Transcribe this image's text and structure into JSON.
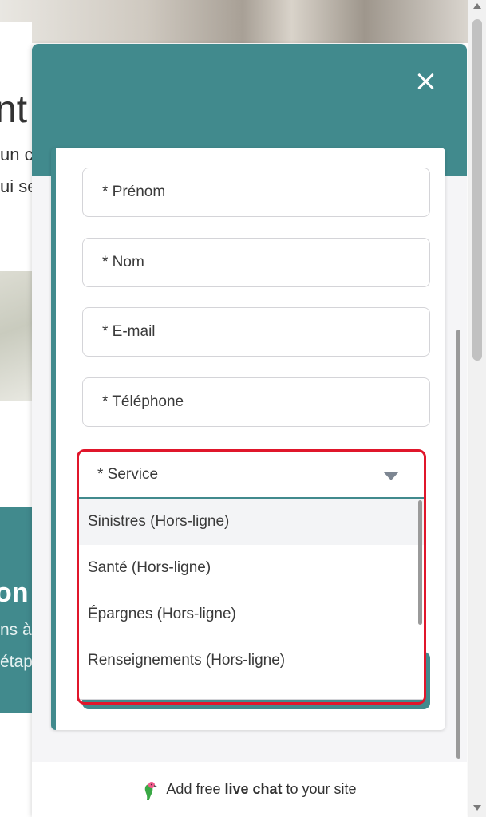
{
  "background": {
    "heading": "nt",
    "text_lines": [
      "un c",
      "ui se"
    ],
    "teal_title": "on",
    "teal_lines": [
      "ns à",
      "étap"
    ]
  },
  "widget": {
    "form": {
      "fields": [
        {
          "placeholder": "* Prénom"
        },
        {
          "placeholder": "* Nom"
        },
        {
          "placeholder": "* E-mail"
        },
        {
          "placeholder": "* Téléphone"
        }
      ],
      "service": {
        "label": "* Service",
        "options": [
          "Sinistres (Hors-ligne)",
          "Santé (Hors-ligne)",
          "Épargnes (Hors-ligne)",
          "Renseignements (Hors-ligne)"
        ]
      }
    },
    "footer": {
      "prefix": "Add free ",
      "bold": "live chat",
      "suffix": " to your site"
    }
  },
  "colors": {
    "teal": "#418a8d",
    "highlight": "#e0162b"
  }
}
